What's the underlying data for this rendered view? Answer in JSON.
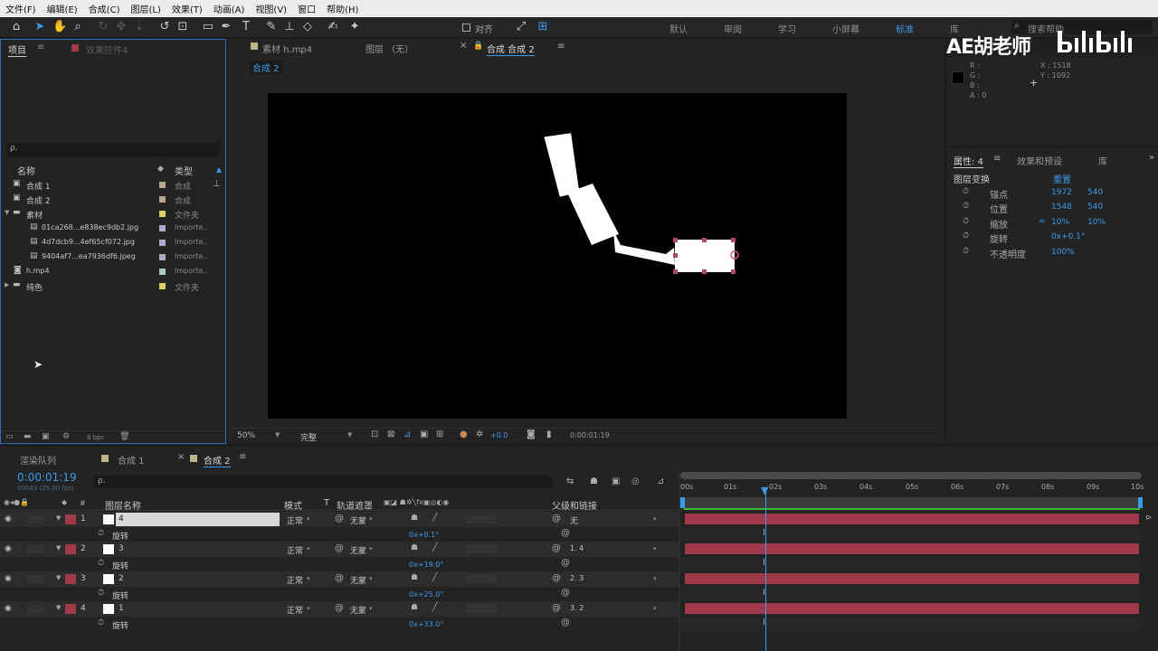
{
  "menu": [
    "文件(F)",
    "编辑(E)",
    "合成(C)",
    "图层(L)",
    "效果(T)",
    "动画(A)",
    "视图(V)",
    "窗口",
    "帮助(H)"
  ],
  "toolbar": {
    "align_label": "对齐",
    "workspaces": [
      "默认",
      "审阅",
      "学习",
      "小屏幕",
      "标准",
      "库"
    ],
    "search_placeholder": "搜索帮助"
  },
  "watermark": {
    "text": "AE胡老师"
  },
  "project": {
    "tab_label": "项目",
    "effects_tab": "效果控件4",
    "search": "ρ.",
    "col_name": "名称",
    "col_type": "类型",
    "bpc": "8 bpc",
    "items": [
      {
        "name": "合成 1",
        "type": "合成",
        "color": "#b8a890"
      },
      {
        "name": "合成 2",
        "type": "合成",
        "color": "#b8a890"
      },
      {
        "name": "素材",
        "type": "文件夹",
        "color": "#d8d060"
      },
      {
        "name": "01ca268...e838ec9db2.jpg",
        "type": "Importe..",
        "color": "#b0a8c8"
      },
      {
        "name": "4d7dcb9...4ef65cf072.jpg",
        "type": "Importe..",
        "color": "#b0a8c8"
      },
      {
        "name": "9404af7...ea7936df6.jpeg",
        "type": "Importe..",
        "color": "#b0a8c8"
      },
      {
        "name": "h.mp4",
        "type": "Importe..",
        "color": "#a8c8c8"
      },
      {
        "name": "纯色",
        "type": "文件夹",
        "color": "#d8d060"
      }
    ]
  },
  "viewer": {
    "tabs": [
      "素材 h.mp4",
      "图层 （无）",
      "合成 合成 2"
    ],
    "breadcrumb": "合成 2",
    "zoom": "50%",
    "quality": "完整",
    "exposure": "+0.0",
    "timecode": "0:00:01:19"
  },
  "info": {
    "r": "R :",
    "g": "G :",
    "b": "B :",
    "a": "A : 0",
    "x": "X : 1518",
    "y": "Y : 1092"
  },
  "properties": {
    "tabs": [
      "属性: 4",
      "效果和预设",
      "库"
    ],
    "section": "图层变换",
    "reset": "重置",
    "rows": [
      {
        "name": "锚点",
        "v1": "1972",
        "v2": "540"
      },
      {
        "name": "位置",
        "v1": "1548",
        "v2": "540"
      },
      {
        "name": "缩放",
        "v1": "10%",
        "v2": "10%"
      },
      {
        "name": "旋转",
        "v1": "0x+0.1°",
        "v2": ""
      },
      {
        "name": "不透明度",
        "v1": "100%",
        "v2": ""
      }
    ]
  },
  "timeline": {
    "tabs": [
      "渲染队列",
      "合成 1",
      "合成 2"
    ],
    "timecode": "0:00:01:19",
    "fps": "00043 (25.00 fps)",
    "search": "ρ.",
    "headers": {
      "layer_name": "图层名称",
      "mode": "模式",
      "t": "T",
      "track_matte": "轨道遮罩",
      "parent": "父级和链接"
    },
    "ruler": [
      "00s",
      "01s",
      "02s",
      "03s",
      "04s",
      "05s",
      "06s",
      "07s",
      "08s",
      "09s",
      "10s"
    ],
    "layers": [
      {
        "num": "1",
        "name": "4",
        "mode": "正常",
        "matte": "无蒙",
        "parent": "无",
        "prop": "旋转",
        "value": "0x+0.1°"
      },
      {
        "num": "2",
        "name": "3",
        "mode": "正常",
        "matte": "无蒙",
        "parent": "1. 4",
        "prop": "旋转",
        "value": "0x+19.0°"
      },
      {
        "num": "3",
        "name": "2",
        "mode": "正常",
        "matte": "无蒙",
        "parent": "2. 3",
        "prop": "旋转",
        "value": "0x+25.0°"
      },
      {
        "num": "4",
        "name": "1",
        "mode": "正常",
        "matte": "无蒙",
        "parent": "3. 2",
        "prop": "旋转",
        "value": "0x+33.0°"
      }
    ]
  }
}
